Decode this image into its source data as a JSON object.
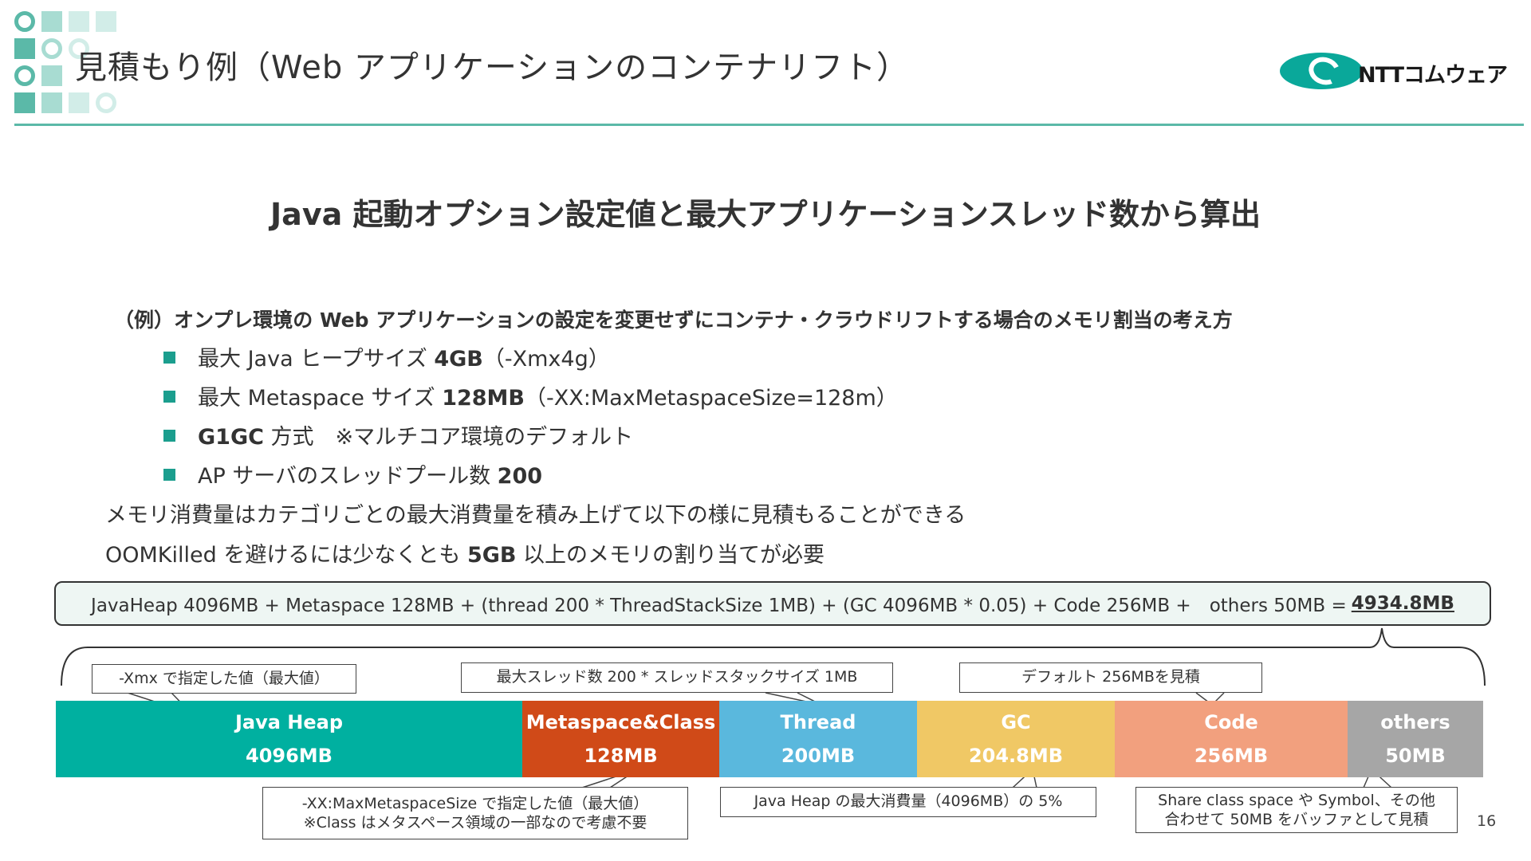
{
  "header": {
    "title": "見積もり例（Web アプリケーションのコンテナリフト）",
    "logo_text": "NTTコムウェア",
    "accent_color": "#5bb9a8"
  },
  "heading": "Java 起動オプション設定値と最大アプリケーションスレッド数から算出",
  "example": {
    "heading": "（例）オンプレ環境の Web アプリケーションの設定を変更せずにコンテナ・クラウドリフトする場合のメモリ割当の考え方",
    "bullets": [
      {
        "pre": "最大 Java ヒープサイズ ",
        "bold": "4GB",
        "post": "（-Xmx4g）"
      },
      {
        "pre": "最大 Metaspace サイズ ",
        "bold": "128MB",
        "post": "（-XX:MaxMetaspaceSize=128m）"
      },
      {
        "pre": "",
        "bold": "G1GC",
        "post": " 方式　※マルチコア環境のデフォルト"
      },
      {
        "pre": "AP サーバのスレッドプール数 ",
        "bold": "200",
        "post": ""
      }
    ],
    "para1": "メモリ消費量はカテゴリごとの最大消費量を積み上げて以下の様に見積もることができる",
    "para2_pre": "OOMKilled を避けるには少なくとも ",
    "para2_bold": "5GB",
    "para2_post": " 以上のメモリの割り当てが必要"
  },
  "formula": {
    "text": "JavaHeap 4096MB + Metaspace 128MB + (thread 200 * ThreadStackSize 1MB) + (GC 4096MB * 0.05) + Code 256MB +　others 50MB =",
    "total": "4934.8MB"
  },
  "callouts": {
    "heap": "-Xmx で指定した値（最大値）",
    "thread": "最大スレッド数 200 * スレッドスタックサイズ 1MB",
    "code": "デフォルト 256MBを見積",
    "meta_line1": "-XX:MaxMetaspaceSize で指定した値（最大値）",
    "meta_line2": "※Class はメタスペース領域の一部なので考慮不要",
    "gc": "Java Heap の最大消費量（4096MB）の 5%",
    "others_line1": "Share class space や Symbol、その他",
    "others_line2": "合わせて 50MB をバッファとして見積"
  },
  "segments": [
    {
      "name": "Java Heap",
      "value": "4096MB",
      "mb": 4096,
      "color": "#00b0a0"
    },
    {
      "name": "Metaspace&Class",
      "value": "128MB",
      "mb": 128,
      "color": "#d04a18"
    },
    {
      "name": "Thread",
      "value": "200MB",
      "mb": 200,
      "color": "#5ab8dd"
    },
    {
      "name": "GC",
      "value": "204.8MB",
      "mb": 204.8,
      "color": "#f0c865"
    },
    {
      "name": "Code",
      "value": "256MB",
      "mb": 256,
      "color": "#f2a07e"
    },
    {
      "name": "others",
      "value": "50MB",
      "mb": 50,
      "color": "#a6a6a6"
    }
  ],
  "page_number": "16"
}
